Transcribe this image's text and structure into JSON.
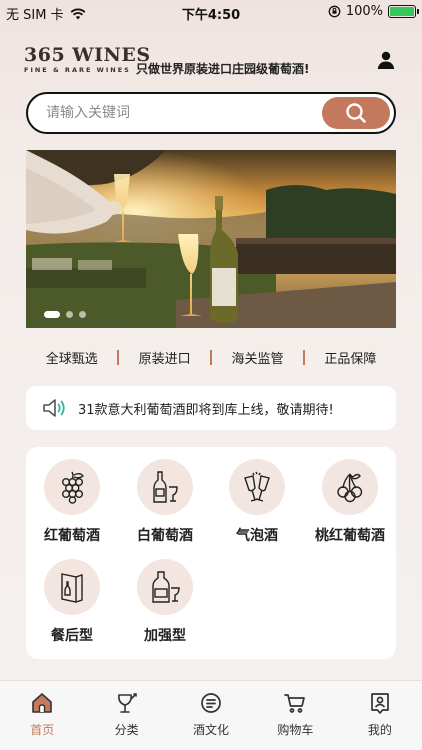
{
  "status": {
    "carrier": "无 SIM 卡",
    "time": "下午4:50",
    "battery": "100%",
    "battery_level": 1.0
  },
  "header": {
    "logo_main": "365 WINES",
    "logo_sub": "FINE & RARE WINES",
    "slogan": "只做世界原装进口庄园级葡萄酒!"
  },
  "search": {
    "placeholder": "请输入关键词"
  },
  "banner": {
    "slide_count": 3,
    "active_index": 0
  },
  "features": [
    "全球甄选",
    "原装进口",
    "海关监管",
    "正品保障"
  ],
  "notice": {
    "text": "31款意大利葡萄酒即将到库上线，敬请期待!"
  },
  "categories": [
    {
      "label": "红葡萄酒",
      "icon": "red-grapes-icon"
    },
    {
      "label": "白葡萄酒",
      "icon": "white-wine-bottle-icon"
    },
    {
      "label": "气泡酒",
      "icon": "champagne-toast-icon"
    },
    {
      "label": "桃红葡萄酒",
      "icon": "cherries-icon"
    },
    {
      "label": "餐后型",
      "icon": "dessert-wine-icon"
    },
    {
      "label": "加强型",
      "icon": "fortified-wine-icon"
    }
  ],
  "tabs": [
    {
      "label": "首页",
      "icon": "home-icon",
      "active": true
    },
    {
      "label": "分类",
      "icon": "wine-glass-icon",
      "active": false
    },
    {
      "label": "酒文化",
      "icon": "culture-icon",
      "active": false
    },
    {
      "label": "购物车",
      "icon": "cart-icon",
      "active": false
    },
    {
      "label": "我的",
      "icon": "profile-icon",
      "active": false
    }
  ],
  "colors": {
    "accent": "#c4795d",
    "category_bg": "#f3e6e1",
    "battery": "#34c759"
  }
}
